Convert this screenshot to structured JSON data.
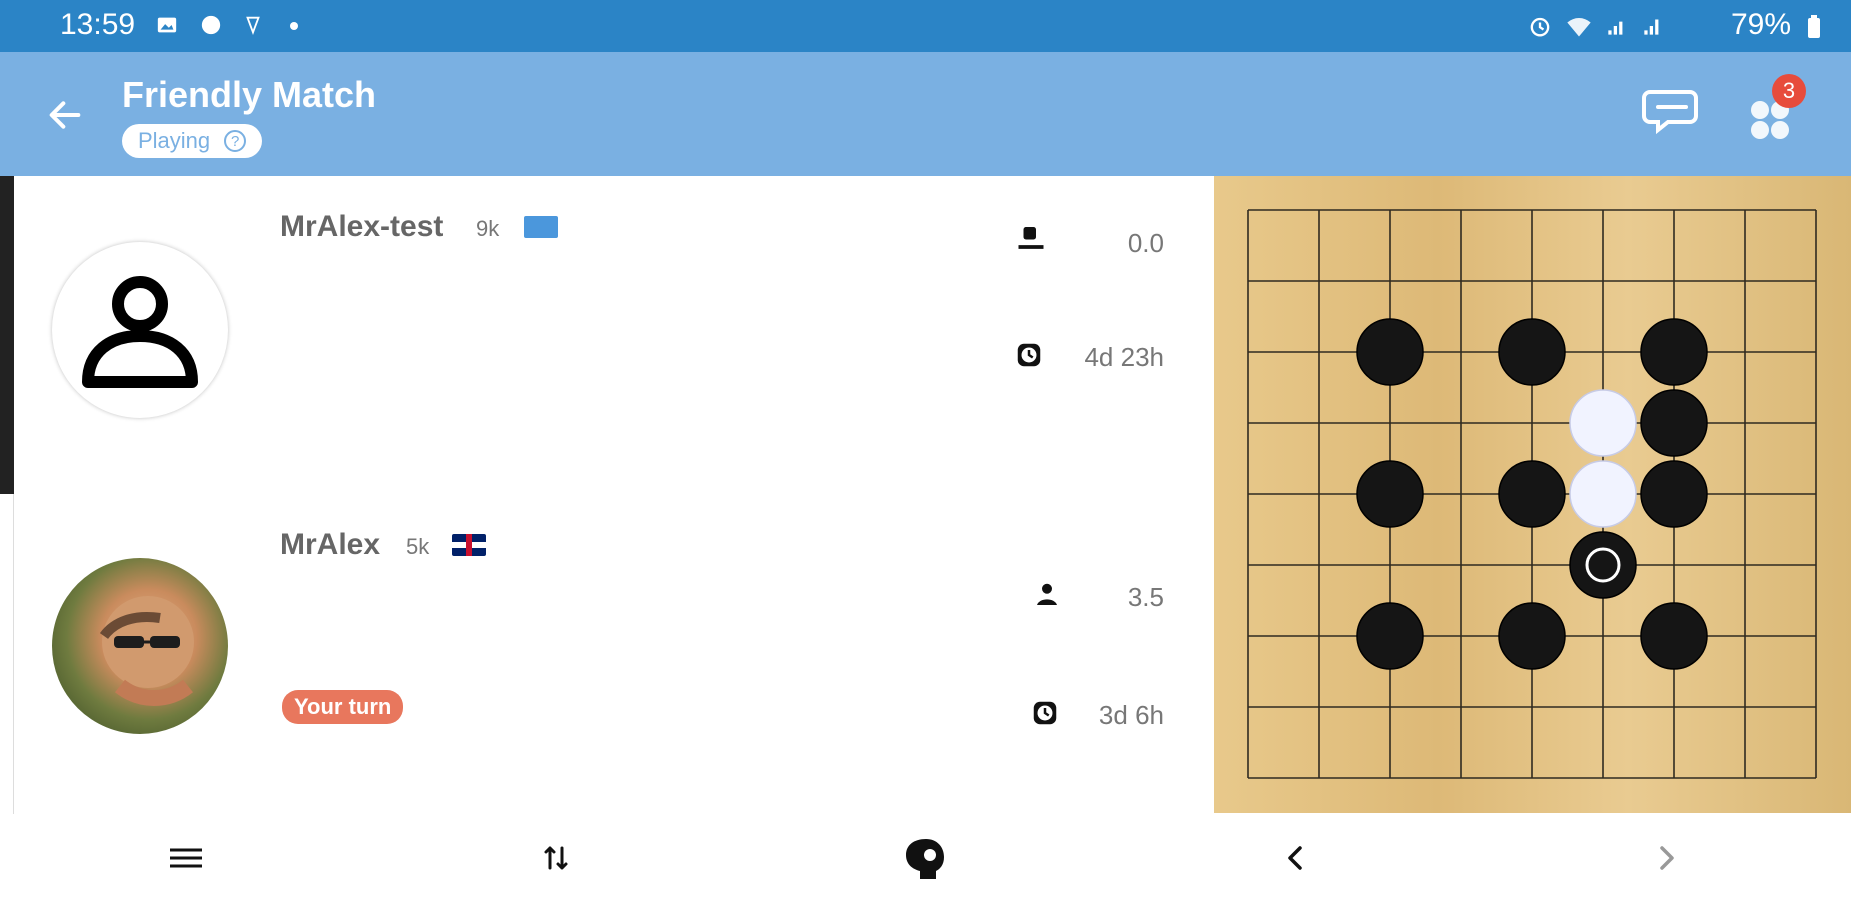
{
  "status_bar": {
    "time": "13:59",
    "battery": "79%",
    "left_icons": [
      "image-icon",
      "chat-bubble-icon",
      "app-icon",
      "dot-icon"
    ],
    "right_icons": [
      "alarm-icon",
      "wifi-icon",
      "signal-icon",
      "signal-icon",
      "battery-icon"
    ]
  },
  "app_bar": {
    "title": "Friendly Match",
    "status": "Playing",
    "badge_count": "3"
  },
  "players": [
    {
      "name": "MrAlex-test",
      "rank": "9k",
      "flag": "UN",
      "score": "0.0",
      "time": "4d 23h"
    },
    {
      "name": "MrAlex",
      "rank": "5k",
      "flag": "UK",
      "score": "3.5",
      "time": "3d 6h",
      "turn_label": "Your turn"
    }
  ],
  "board": {
    "size": 9,
    "black_stones": [
      [
        2,
        2
      ],
      [
        4,
        2
      ],
      [
        6,
        2
      ],
      [
        6,
        3
      ],
      [
        2,
        4
      ],
      [
        4,
        4
      ],
      [
        6,
        4
      ],
      [
        5,
        5
      ],
      [
        2,
        6
      ],
      [
        4,
        6
      ],
      [
        6,
        6
      ]
    ],
    "white_stones": [
      [
        5,
        3
      ],
      [
        5,
        4
      ]
    ],
    "last_move": [
      5,
      5
    ]
  },
  "colors": {
    "status_bar": "#2b84c6",
    "app_bar": "#7ab0e2",
    "your_turn": "#e8775d",
    "badge": "#e74c3c",
    "board": "#e3c283"
  },
  "bottom_nav": [
    "menu-icon",
    "swap-icon",
    "brain-icon",
    "chevron-left-icon",
    "chevron-right-icon"
  ]
}
